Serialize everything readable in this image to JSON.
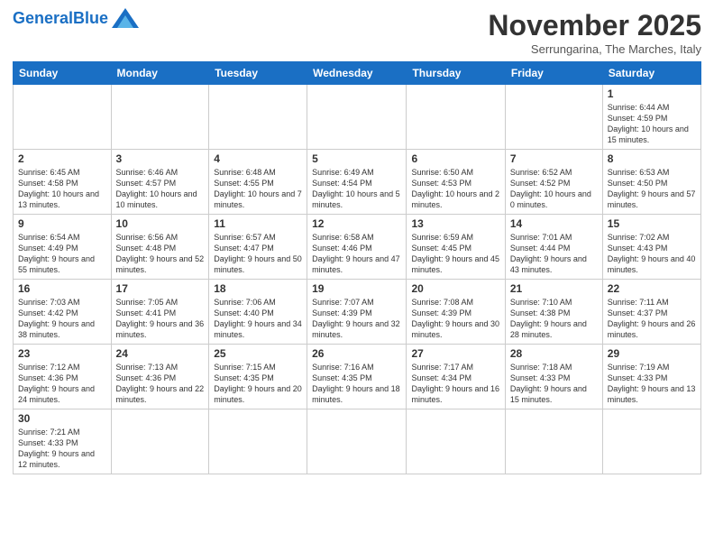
{
  "header": {
    "logo_general": "General",
    "logo_blue": "Blue",
    "month_title": "November 2025",
    "subtitle": "Serrungarina, The Marches, Italy"
  },
  "days_of_week": [
    "Sunday",
    "Monday",
    "Tuesday",
    "Wednesday",
    "Thursday",
    "Friday",
    "Saturday"
  ],
  "weeks": [
    [
      {
        "day": "",
        "info": ""
      },
      {
        "day": "",
        "info": ""
      },
      {
        "day": "",
        "info": ""
      },
      {
        "day": "",
        "info": ""
      },
      {
        "day": "",
        "info": ""
      },
      {
        "day": "",
        "info": ""
      },
      {
        "day": "1",
        "info": "Sunrise: 6:44 AM\nSunset: 4:59 PM\nDaylight: 10 hours and 15 minutes."
      }
    ],
    [
      {
        "day": "2",
        "info": "Sunrise: 6:45 AM\nSunset: 4:58 PM\nDaylight: 10 hours and 13 minutes."
      },
      {
        "day": "3",
        "info": "Sunrise: 6:46 AM\nSunset: 4:57 PM\nDaylight: 10 hours and 10 minutes."
      },
      {
        "day": "4",
        "info": "Sunrise: 6:48 AM\nSunset: 4:55 PM\nDaylight: 10 hours and 7 minutes."
      },
      {
        "day": "5",
        "info": "Sunrise: 6:49 AM\nSunset: 4:54 PM\nDaylight: 10 hours and 5 minutes."
      },
      {
        "day": "6",
        "info": "Sunrise: 6:50 AM\nSunset: 4:53 PM\nDaylight: 10 hours and 2 minutes."
      },
      {
        "day": "7",
        "info": "Sunrise: 6:52 AM\nSunset: 4:52 PM\nDaylight: 10 hours and 0 minutes."
      },
      {
        "day": "8",
        "info": "Sunrise: 6:53 AM\nSunset: 4:50 PM\nDaylight: 9 hours and 57 minutes."
      }
    ],
    [
      {
        "day": "9",
        "info": "Sunrise: 6:54 AM\nSunset: 4:49 PM\nDaylight: 9 hours and 55 minutes."
      },
      {
        "day": "10",
        "info": "Sunrise: 6:56 AM\nSunset: 4:48 PM\nDaylight: 9 hours and 52 minutes."
      },
      {
        "day": "11",
        "info": "Sunrise: 6:57 AM\nSunset: 4:47 PM\nDaylight: 9 hours and 50 minutes."
      },
      {
        "day": "12",
        "info": "Sunrise: 6:58 AM\nSunset: 4:46 PM\nDaylight: 9 hours and 47 minutes."
      },
      {
        "day": "13",
        "info": "Sunrise: 6:59 AM\nSunset: 4:45 PM\nDaylight: 9 hours and 45 minutes."
      },
      {
        "day": "14",
        "info": "Sunrise: 7:01 AM\nSunset: 4:44 PM\nDaylight: 9 hours and 43 minutes."
      },
      {
        "day": "15",
        "info": "Sunrise: 7:02 AM\nSunset: 4:43 PM\nDaylight: 9 hours and 40 minutes."
      }
    ],
    [
      {
        "day": "16",
        "info": "Sunrise: 7:03 AM\nSunset: 4:42 PM\nDaylight: 9 hours and 38 minutes."
      },
      {
        "day": "17",
        "info": "Sunrise: 7:05 AM\nSunset: 4:41 PM\nDaylight: 9 hours and 36 minutes."
      },
      {
        "day": "18",
        "info": "Sunrise: 7:06 AM\nSunset: 4:40 PM\nDaylight: 9 hours and 34 minutes."
      },
      {
        "day": "19",
        "info": "Sunrise: 7:07 AM\nSunset: 4:39 PM\nDaylight: 9 hours and 32 minutes."
      },
      {
        "day": "20",
        "info": "Sunrise: 7:08 AM\nSunset: 4:39 PM\nDaylight: 9 hours and 30 minutes."
      },
      {
        "day": "21",
        "info": "Sunrise: 7:10 AM\nSunset: 4:38 PM\nDaylight: 9 hours and 28 minutes."
      },
      {
        "day": "22",
        "info": "Sunrise: 7:11 AM\nSunset: 4:37 PM\nDaylight: 9 hours and 26 minutes."
      }
    ],
    [
      {
        "day": "23",
        "info": "Sunrise: 7:12 AM\nSunset: 4:36 PM\nDaylight: 9 hours and 24 minutes."
      },
      {
        "day": "24",
        "info": "Sunrise: 7:13 AM\nSunset: 4:36 PM\nDaylight: 9 hours and 22 minutes."
      },
      {
        "day": "25",
        "info": "Sunrise: 7:15 AM\nSunset: 4:35 PM\nDaylight: 9 hours and 20 minutes."
      },
      {
        "day": "26",
        "info": "Sunrise: 7:16 AM\nSunset: 4:35 PM\nDaylight: 9 hours and 18 minutes."
      },
      {
        "day": "27",
        "info": "Sunrise: 7:17 AM\nSunset: 4:34 PM\nDaylight: 9 hours and 16 minutes."
      },
      {
        "day": "28",
        "info": "Sunrise: 7:18 AM\nSunset: 4:33 PM\nDaylight: 9 hours and 15 minutes."
      },
      {
        "day": "29",
        "info": "Sunrise: 7:19 AM\nSunset: 4:33 PM\nDaylight: 9 hours and 13 minutes."
      }
    ],
    [
      {
        "day": "30",
        "info": "Sunrise: 7:21 AM\nSunset: 4:33 PM\nDaylight: 9 hours and 12 minutes."
      },
      {
        "day": "",
        "info": ""
      },
      {
        "day": "",
        "info": ""
      },
      {
        "day": "",
        "info": ""
      },
      {
        "day": "",
        "info": ""
      },
      {
        "day": "",
        "info": ""
      },
      {
        "day": "",
        "info": ""
      }
    ]
  ]
}
